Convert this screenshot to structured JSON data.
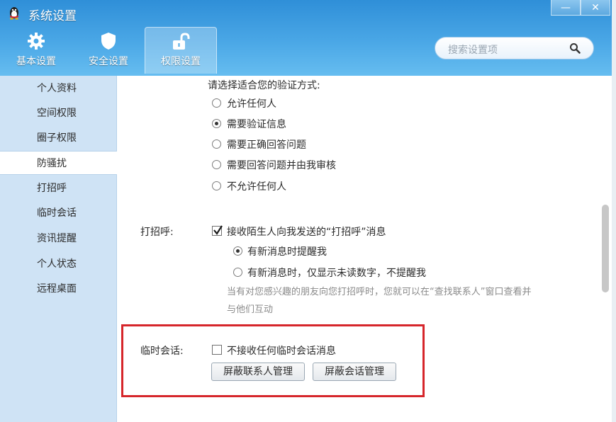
{
  "window": {
    "title": "系统设置",
    "minimize_icon": "minimize-icon",
    "close_icon": "close-icon",
    "minimize_glyph": "—",
    "close_glyph": "✕"
  },
  "toolbar": {
    "tabs": [
      {
        "label": "基本设置",
        "icon": "gear-icon"
      },
      {
        "label": "安全设置",
        "icon": "shield-icon"
      },
      {
        "label": "权限设置",
        "icon": "unlock-icon",
        "active": true
      }
    ]
  },
  "search": {
    "placeholder": "搜索设置项",
    "icon": "search-icon"
  },
  "sidebar": {
    "items": [
      {
        "label": "个人资料"
      },
      {
        "label": "空间权限"
      },
      {
        "label": "圈子权限"
      },
      {
        "label": "防骚扰",
        "active": true
      },
      {
        "label": "打招呼"
      },
      {
        "label": "临时会话"
      },
      {
        "label": "资讯提醒"
      },
      {
        "label": "个人状态"
      },
      {
        "label": "远程桌面"
      }
    ]
  },
  "verification": {
    "prompt": "请选择适合您的验证方式:",
    "options": [
      {
        "label": "允许任何人",
        "selected": false
      },
      {
        "label": "需要验证信息",
        "selected": true
      },
      {
        "label": "需要正确回答问题",
        "selected": false
      },
      {
        "label": "需要回答问题并由我审核",
        "selected": false
      },
      {
        "label": "不允许任何人",
        "selected": false
      }
    ]
  },
  "greeting": {
    "label": "打招呼:",
    "checkbox_label": "接收陌生人向我发送的“打招呼”消息",
    "checked": true,
    "options": [
      {
        "label": "有新消息时提醒我",
        "selected": true
      },
      {
        "label": "有新消息时，仅显示未读数字，不提醒我",
        "selected": false
      }
    ],
    "hint_line1": "当有对您感兴趣的朋友向您打招呼时，您就可以在“查找联系人”窗口查看并",
    "hint_line2": "与他们互动"
  },
  "temp_session": {
    "label": "临时会话:",
    "checkbox_label": "不接收任何临时会话消息",
    "checked": false,
    "buttons": {
      "block_contacts": "屏蔽联系人管理",
      "block_sessions": "屏蔽会话管理"
    }
  },
  "colors": {
    "header": "#4aa7e6",
    "sidebar": "#cfe3f5",
    "highlight": "#d6262b"
  }
}
